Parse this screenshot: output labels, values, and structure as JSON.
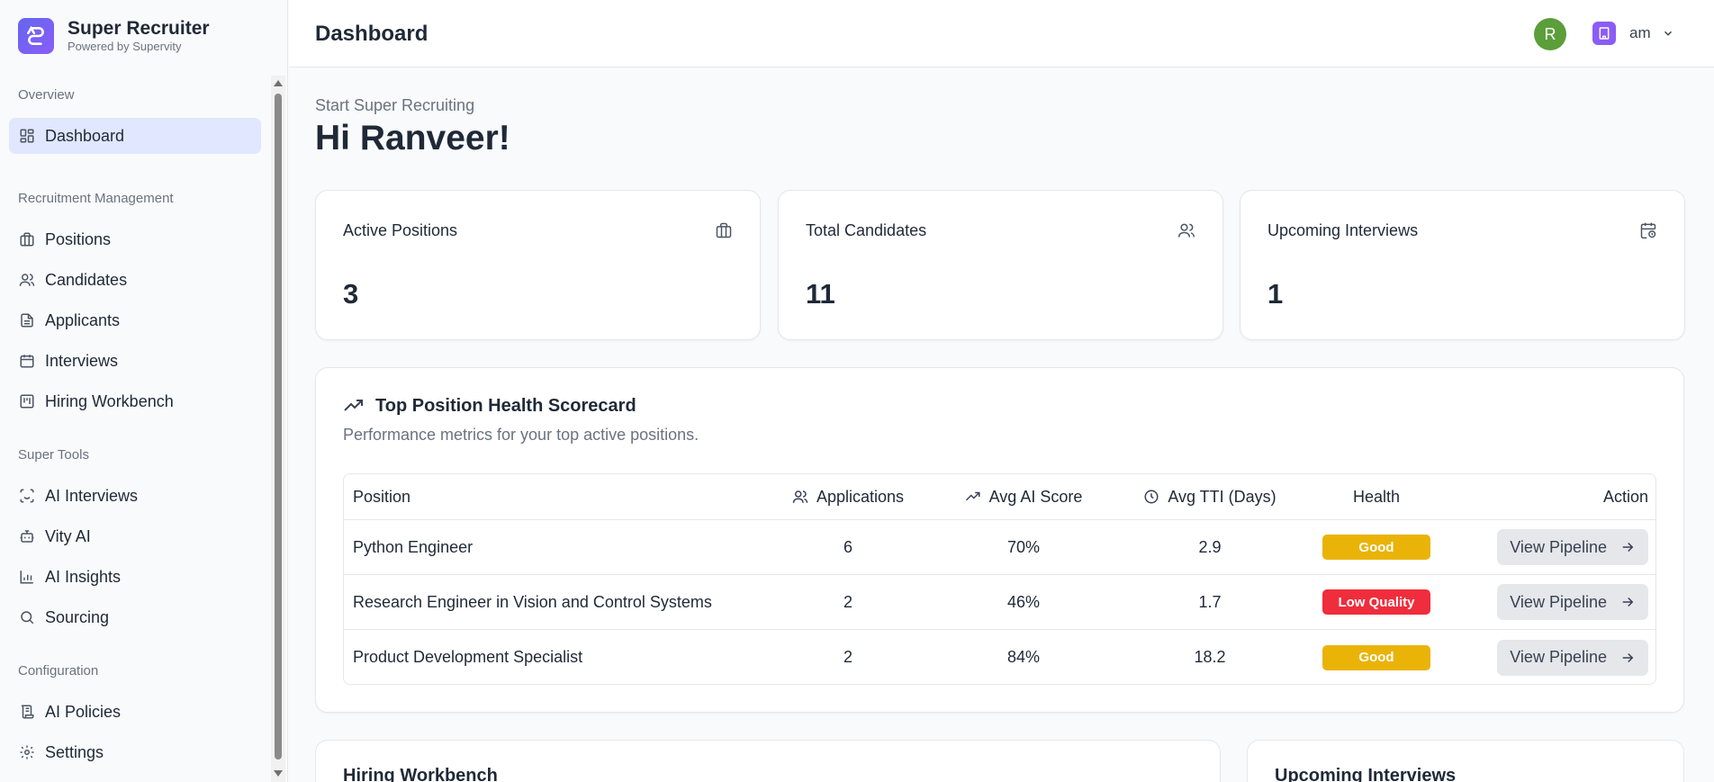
{
  "app": {
    "name": "Super Recruiter",
    "tagline": "Powered by Supervity"
  },
  "sidebar": {
    "sections": [
      {
        "title": "Overview",
        "items": [
          {
            "label": "Dashboard",
            "icon": "dashboard-icon",
            "active": true
          }
        ]
      },
      {
        "title": "Recruitment Management",
        "items": [
          {
            "label": "Positions",
            "icon": "briefcase-icon"
          },
          {
            "label": "Candidates",
            "icon": "users-icon"
          },
          {
            "label": "Applicants",
            "icon": "document-icon"
          },
          {
            "label": "Interviews",
            "icon": "calendar-icon"
          },
          {
            "label": "Hiring Workbench",
            "icon": "kanban-icon"
          }
        ]
      },
      {
        "title": "Super Tools",
        "items": [
          {
            "label": "AI Interviews",
            "icon": "scan-face-icon"
          },
          {
            "label": "Vity AI",
            "icon": "bot-icon"
          },
          {
            "label": "AI Insights",
            "icon": "bar-chart-icon"
          },
          {
            "label": "Sourcing",
            "icon": "search-icon"
          }
        ]
      },
      {
        "title": "Configuration",
        "items": [
          {
            "label": "AI Policies",
            "icon": "scroll-icon"
          },
          {
            "label": "Settings",
            "icon": "gear-icon"
          }
        ]
      }
    ]
  },
  "header": {
    "title": "Dashboard",
    "avatar_initial": "R",
    "avatar_color": "#5b9e3a",
    "org_label": "am",
    "org_color": "#8b5cf6"
  },
  "main": {
    "subgreeting": "Start Super Recruiting",
    "greeting": "Hi Ranveer!",
    "stats": [
      {
        "label": "Active Positions",
        "value": "3",
        "icon": "briefcase-icon"
      },
      {
        "label": "Total Candidates",
        "value": "11",
        "icon": "users-icon"
      },
      {
        "label": "Upcoming Interviews",
        "value": "1",
        "icon": "calendar-clock-icon"
      }
    ],
    "scorecard": {
      "title": "Top Position Health Scorecard",
      "description": "Performance metrics for your top active positions.",
      "columns": {
        "position": "Position",
        "applications": "Applications",
        "avg_ai_score": "Avg AI Score",
        "avg_tti": "Avg TTI (Days)",
        "health": "Health",
        "action": "Action"
      },
      "rows": [
        {
          "position": "Python Engineer",
          "applications": "6",
          "avg_ai_score": "70%",
          "avg_tti": "2.9",
          "health": "Good",
          "health_color": "#eab308",
          "action": "View Pipeline"
        },
        {
          "position": "Research Engineer in Vision and Control Systems",
          "applications": "2",
          "avg_ai_score": "46%",
          "avg_tti": "1.7",
          "health": "Low Quality",
          "health_color": "#ef2d3c",
          "action": "View Pipeline"
        },
        {
          "position": "Product Development Specialist",
          "applications": "2",
          "avg_ai_score": "84%",
          "avg_tti": "18.2",
          "health": "Good",
          "health_color": "#eab308",
          "action": "View Pipeline"
        }
      ]
    },
    "bottom_cards": {
      "hiring_workbench": "Hiring Workbench",
      "upcoming_interviews": "Upcoming Interviews"
    }
  },
  "colors": {
    "accent": "#6366f1",
    "active_nav_bg": "#e0e7ff"
  }
}
